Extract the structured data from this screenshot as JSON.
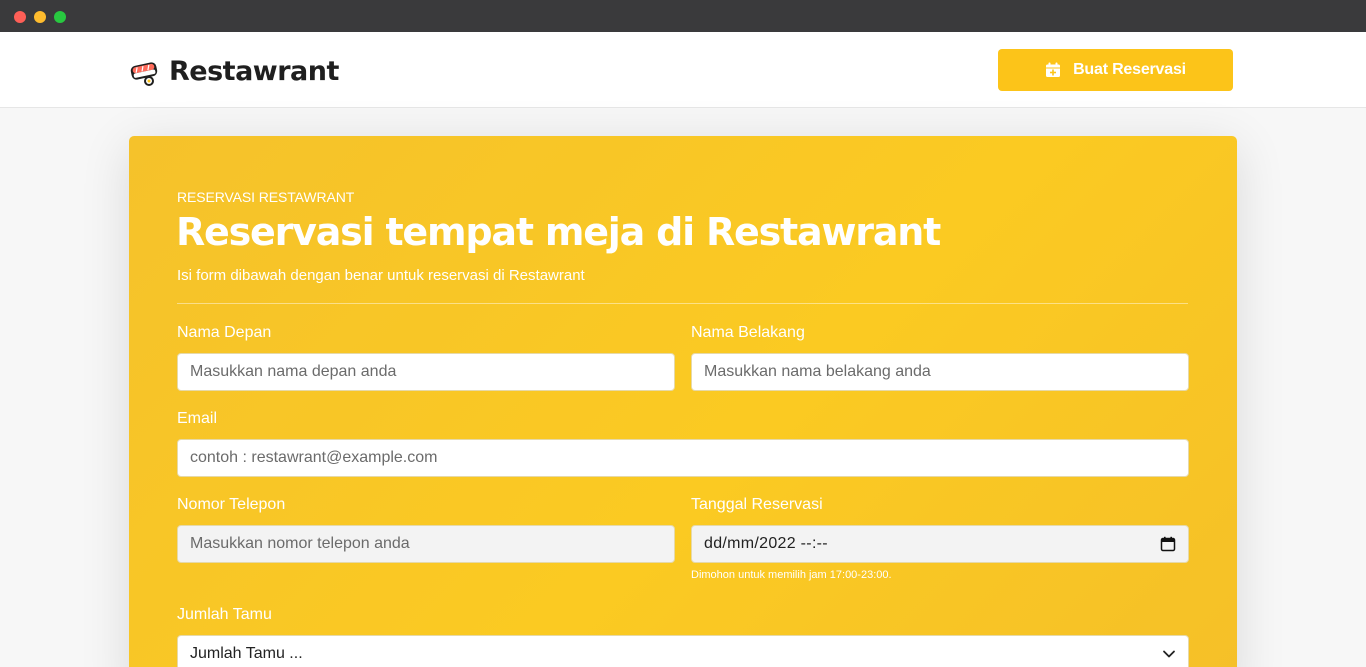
{
  "brand": {
    "name": "Restawrant"
  },
  "navbar": {
    "cta_label": "Buat Reservasi"
  },
  "hero": {
    "eyebrow": "RESERVASI RESTAWRANT",
    "title": "Reservasi tempat meja di Restawrant",
    "subtitle": "Isi form dibawah dengan benar untuk reservasi di Restawrant"
  },
  "form": {
    "first_name": {
      "label": "Nama Depan",
      "placeholder": "Masukkan nama depan anda"
    },
    "last_name": {
      "label": "Nama Belakang",
      "placeholder": "Masukkan nama belakang anda"
    },
    "email": {
      "label": "Email",
      "placeholder": "contoh : restawrant@example.com"
    },
    "phone": {
      "label": "Nomor Telepon",
      "placeholder": "Masukkan nomor telepon anda"
    },
    "date": {
      "label": "Tanggal Reservasi",
      "value": "dd/mm/2022 --:--",
      "hint": "Dimohon untuk memilih jam 17:00-23:00."
    },
    "guests": {
      "label": "Jumlah Tamu",
      "selected": "Jumlah Tamu ..."
    }
  },
  "colors": {
    "accent": "#fcc419",
    "card": "#f8c626",
    "text_dark": "#1f1f1f"
  },
  "icons": {
    "logo": "sushi-logo-icon",
    "cta": "calendar-plus-icon",
    "date": "calendar-icon",
    "select": "chevron-down-icon"
  }
}
